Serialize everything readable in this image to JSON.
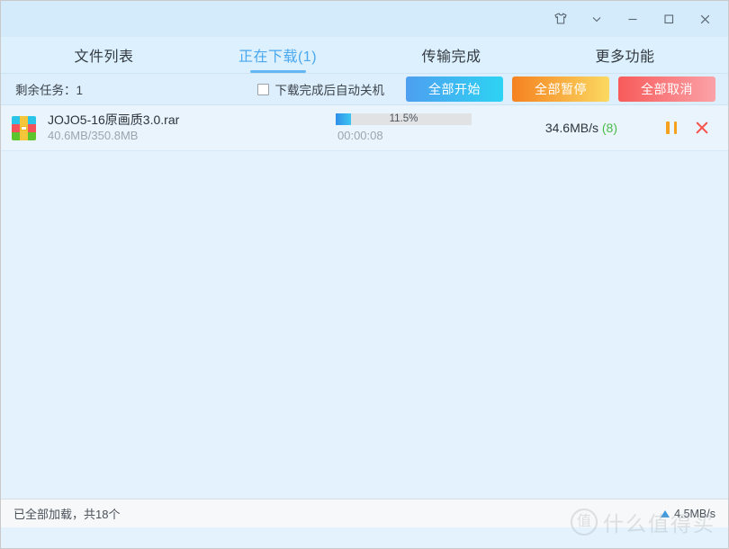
{
  "window": {
    "titlebar_buttons": [
      {
        "name": "skin-icon",
        "label": "换肤"
      },
      {
        "name": "chevron-down-icon",
        "label": "更多"
      },
      {
        "name": "minimize-icon",
        "label": "最小化"
      },
      {
        "name": "maximize-icon",
        "label": "最大化"
      },
      {
        "name": "close-icon",
        "label": "关闭"
      }
    ]
  },
  "tabs": [
    {
      "label": "文件列表",
      "active": false
    },
    {
      "label": "正在下载(1)",
      "active": true
    },
    {
      "label": "传输完成",
      "active": false
    },
    {
      "label": "更多功能",
      "active": false
    }
  ],
  "toolbar": {
    "remaining_tasks": "剩余任务：1",
    "auto_shutdown_label": "下载完成后自动关机",
    "auto_shutdown_checked": false,
    "start_all_label": "全部开始",
    "pause_all_label": "全部暂停",
    "cancel_all_label": "全部取消",
    "start_all_color": "#4e9ff0",
    "pause_all_color": "#f58220",
    "cancel_all_color": "#f85a5a"
  },
  "tasks": [
    {
      "file_name": "JOJO5-16原画质3.0.rar",
      "file_size": "40.6MB/350.8MB",
      "progress_percent": "11.5%",
      "progress_value": 11.5,
      "elapsed_time": "00:00:08",
      "speed": "34.6MB/s",
      "connections": "(8)",
      "file_type": "rar-archive-icon"
    }
  ],
  "status": {
    "load_text": "已全部加载，共18个",
    "upload_speed": "4.5MB/s"
  },
  "watermark": {
    "badge": "值",
    "text": "什么值得买"
  }
}
